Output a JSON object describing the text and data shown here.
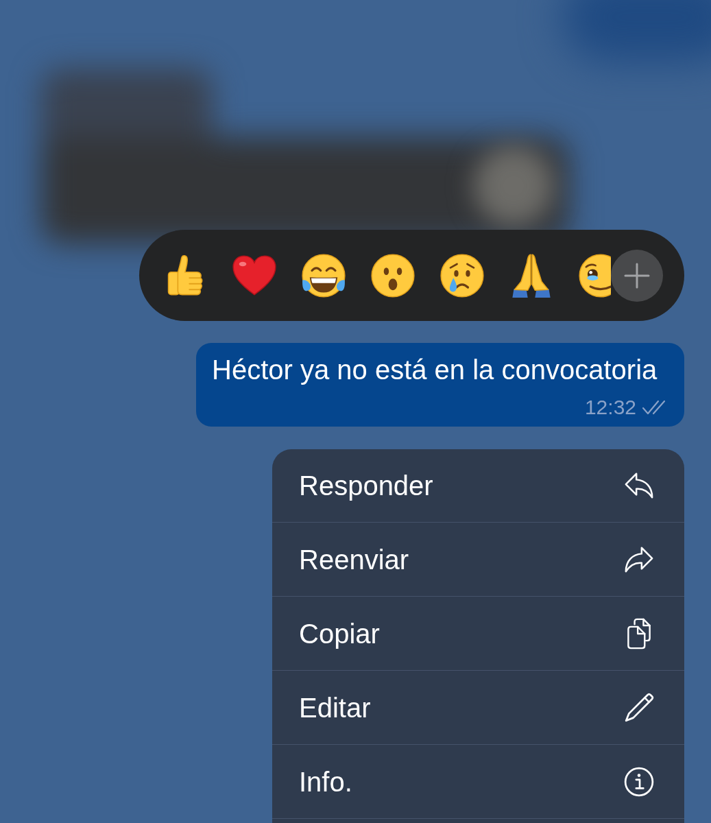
{
  "reaction_bar": {
    "reactions": [
      {
        "kind": "thumbs_up"
      },
      {
        "kind": "red_heart"
      },
      {
        "kind": "tears_of_joy"
      },
      {
        "kind": "surprised"
      },
      {
        "kind": "crying"
      },
      {
        "kind": "folded_hands"
      },
      {
        "kind": "holding_back_tears"
      }
    ]
  },
  "message": {
    "text": "Héctor ya no está en la convocatoria",
    "time": "12:32",
    "read": true
  },
  "context_menu": {
    "items": [
      {
        "label": "Responder",
        "kind": "reply"
      },
      {
        "label": "Reenviar",
        "kind": "forward"
      },
      {
        "label": "Copiar",
        "kind": "copy"
      },
      {
        "label": "Editar",
        "kind": "edit"
      },
      {
        "label": "Info.",
        "kind": "info"
      }
    ]
  }
}
